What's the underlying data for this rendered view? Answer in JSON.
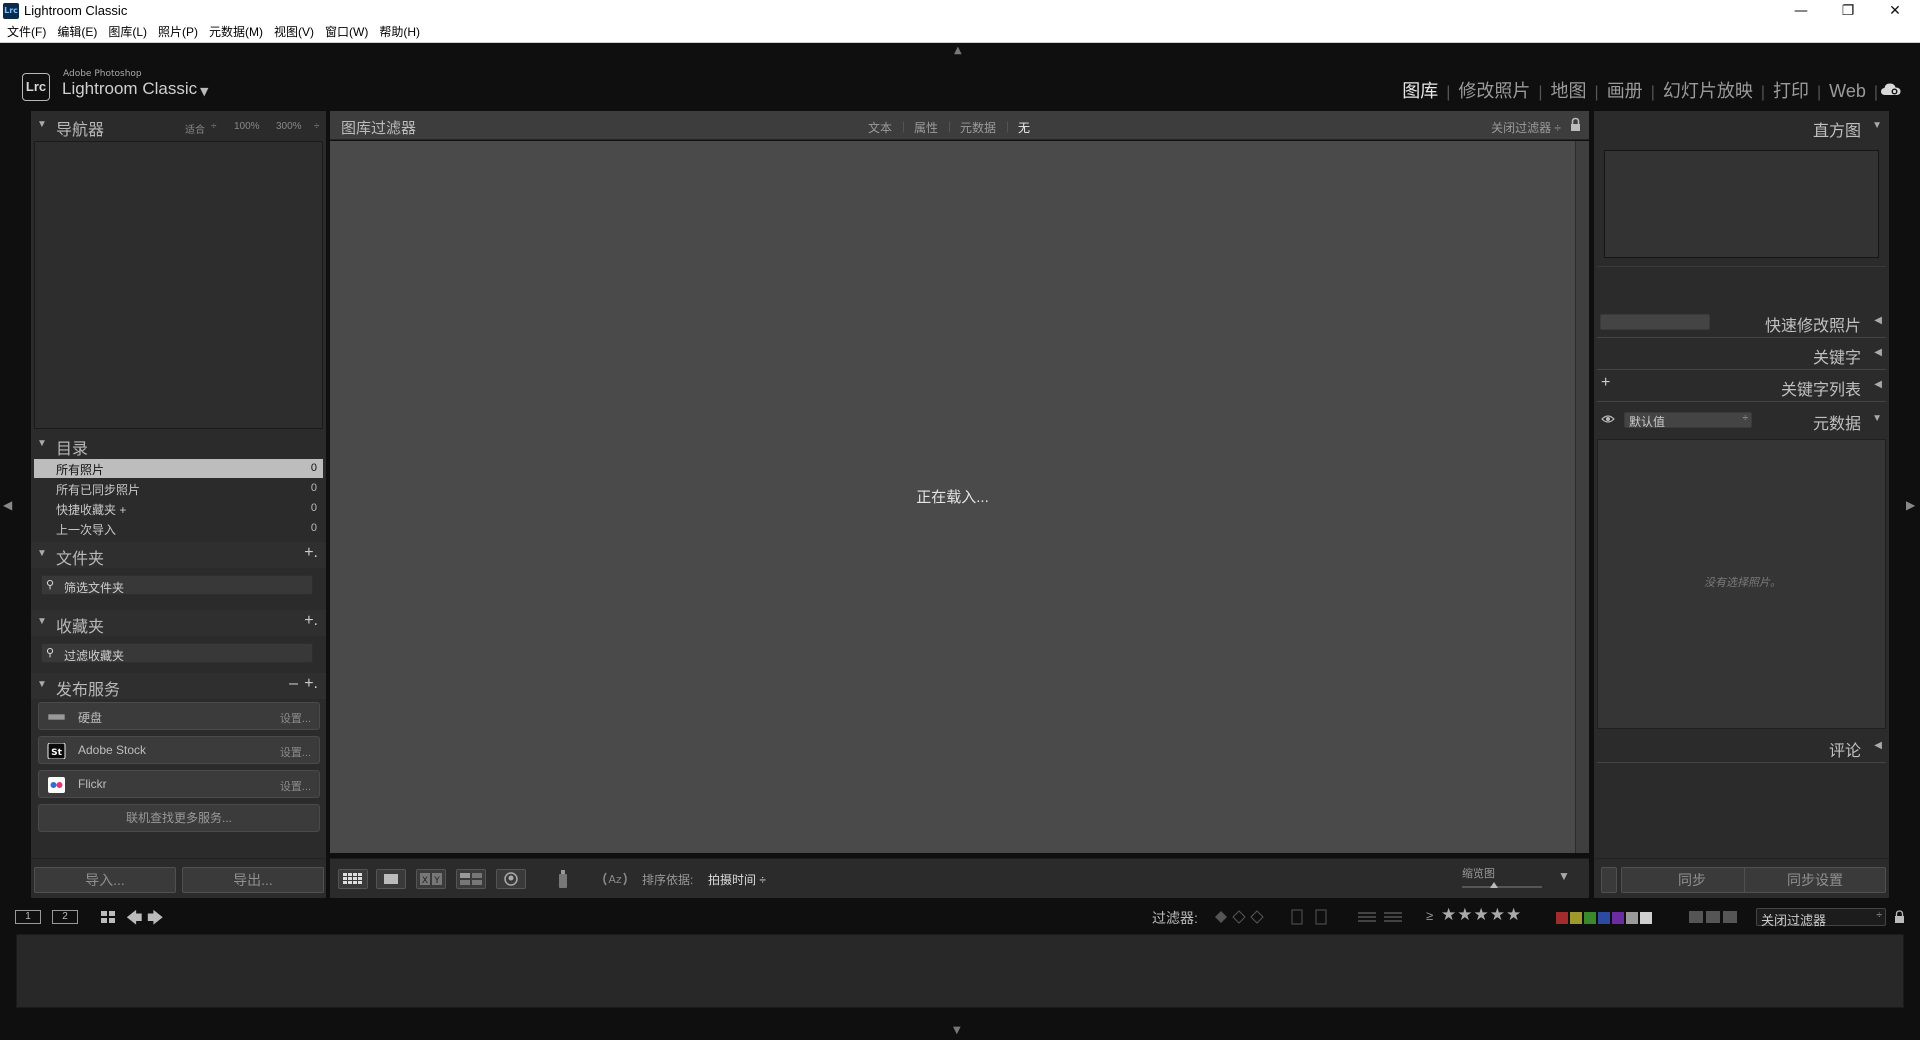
{
  "window": {
    "title": "Lightroom Classic",
    "icon_label": "Lrc",
    "controls": [
      "—",
      "❐",
      "✕"
    ]
  },
  "menu": [
    "文件(F)",
    "编辑(E)",
    "图库(L)",
    "照片(P)",
    "元数据(M)",
    "视图(V)",
    "窗口(W)",
    "帮助(H)"
  ],
  "identity": {
    "logo": "Lrc",
    "adobe": "Adobe Photoshop",
    "product": "Lightroom Classic"
  },
  "modules": [
    "图库",
    "修改照片",
    "地图",
    "画册",
    "幻灯片放映",
    "打印",
    "Web"
  ],
  "left": {
    "navigator": {
      "title": "导航器",
      "fit": "适合",
      "z1": "100%",
      "z2": "300%"
    },
    "catalog": {
      "title": "目录",
      "items": [
        {
          "name": "所有照片",
          "count": "0"
        },
        {
          "name": "所有已同步照片",
          "count": "0"
        },
        {
          "name": "快捷收藏夹 +",
          "count": "0"
        },
        {
          "name": "上一次导入",
          "count": "0"
        }
      ]
    },
    "folders": {
      "title": "文件夹",
      "search": "筛选文件夹"
    },
    "collections": {
      "title": "收藏夹",
      "search": "过滤收藏夹"
    },
    "publish": {
      "title": "发布服务",
      "services": [
        {
          "name": "硬盘",
          "setup": "设置..."
        },
        {
          "name": "Adobe Stock",
          "setup": "设置..."
        },
        {
          "name": "Flickr",
          "setup": "设置..."
        }
      ],
      "more": "联机查找更多服务..."
    },
    "import_btn": "导入...",
    "export_btn": "导出..."
  },
  "filter": {
    "title": "图库过滤器",
    "options": [
      "文本",
      "属性",
      "元数据",
      "无"
    ],
    "preset": "关闭过滤器 ÷"
  },
  "center": {
    "loading": "正在载入..."
  },
  "toolbar": {
    "sort_label": "排序依据:",
    "sort_value": "拍摄时间 ÷",
    "thumb_label": "缩览图"
  },
  "right": {
    "histogram": "直方图",
    "quick_develop": "快速修改照片",
    "keywording": "关键字",
    "keyword_list": "关键字列表",
    "metadata": "元数据",
    "metadata_preset": "默认值",
    "no_photo": "没有选择照片。",
    "comments": "评论",
    "sync": "同步",
    "sync_settings": "同步设置"
  },
  "filmstrip": {
    "screen1": "1",
    "screen2": "2",
    "filter_label": "过滤器:",
    "rating_op": "≥",
    "stars": "★★★★★",
    "filter_preset": "关闭过滤器",
    "color_labels": [
      "#a02c2c",
      "#a09a2c",
      "#3a8a2c",
      "#2c4aa0",
      "#6a2ca0",
      "#9a9a9a",
      "#cfcfcf"
    ]
  },
  "colors": {
    "background": "#0f0f0f",
    "panel": "#2b2b2b",
    "grid": "#4a4a4a",
    "selected_row": "#bdbdbd"
  }
}
